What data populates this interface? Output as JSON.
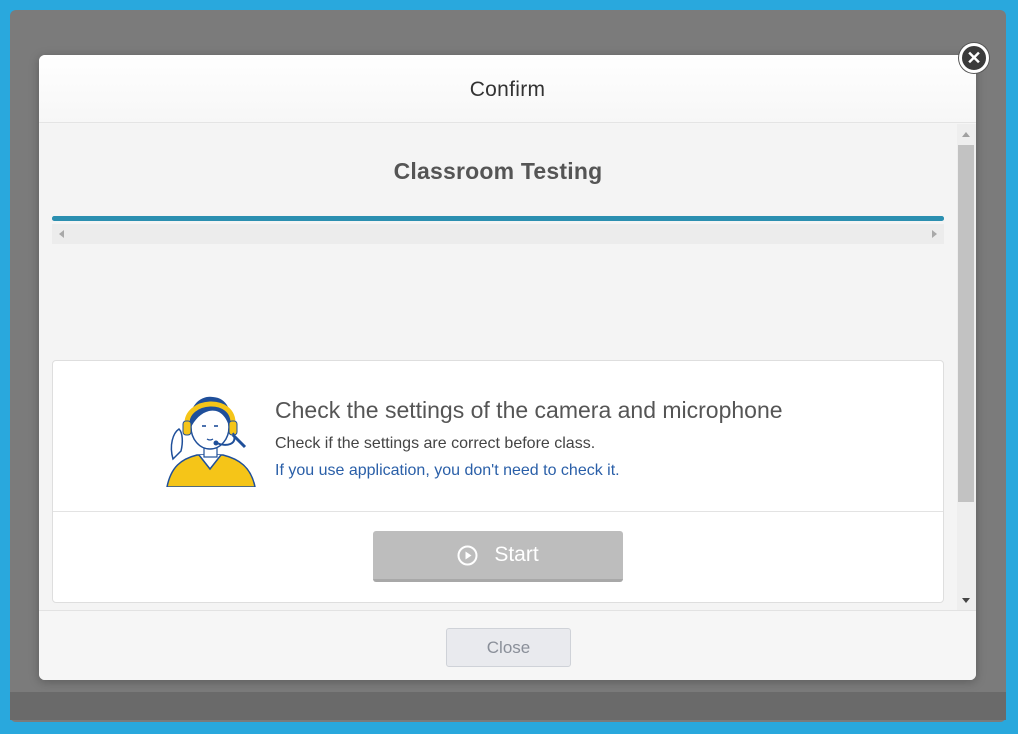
{
  "dialog": {
    "title": "Confirm",
    "close_button_label": "Close"
  },
  "body": {
    "section_title": "Classroom Testing",
    "progress": 1.0
  },
  "card": {
    "heading": "Check the settings of the camera and microphone",
    "subtext": "Check if the settings are correct before class.",
    "note": "If you use application, you don't need to check it.",
    "start_label": "Start"
  },
  "icons": {
    "close": "close-icon",
    "play": "play-circle-icon",
    "illustration": "headset-person-illustration"
  },
  "colors": {
    "frame": "#29a8dd",
    "progress": "#2b8fb0",
    "note_link": "#2a5fa8",
    "start_button": "#bdbdbd",
    "illustration_yellow": "#f5c518",
    "illustration_blue": "#1f4f9a"
  }
}
